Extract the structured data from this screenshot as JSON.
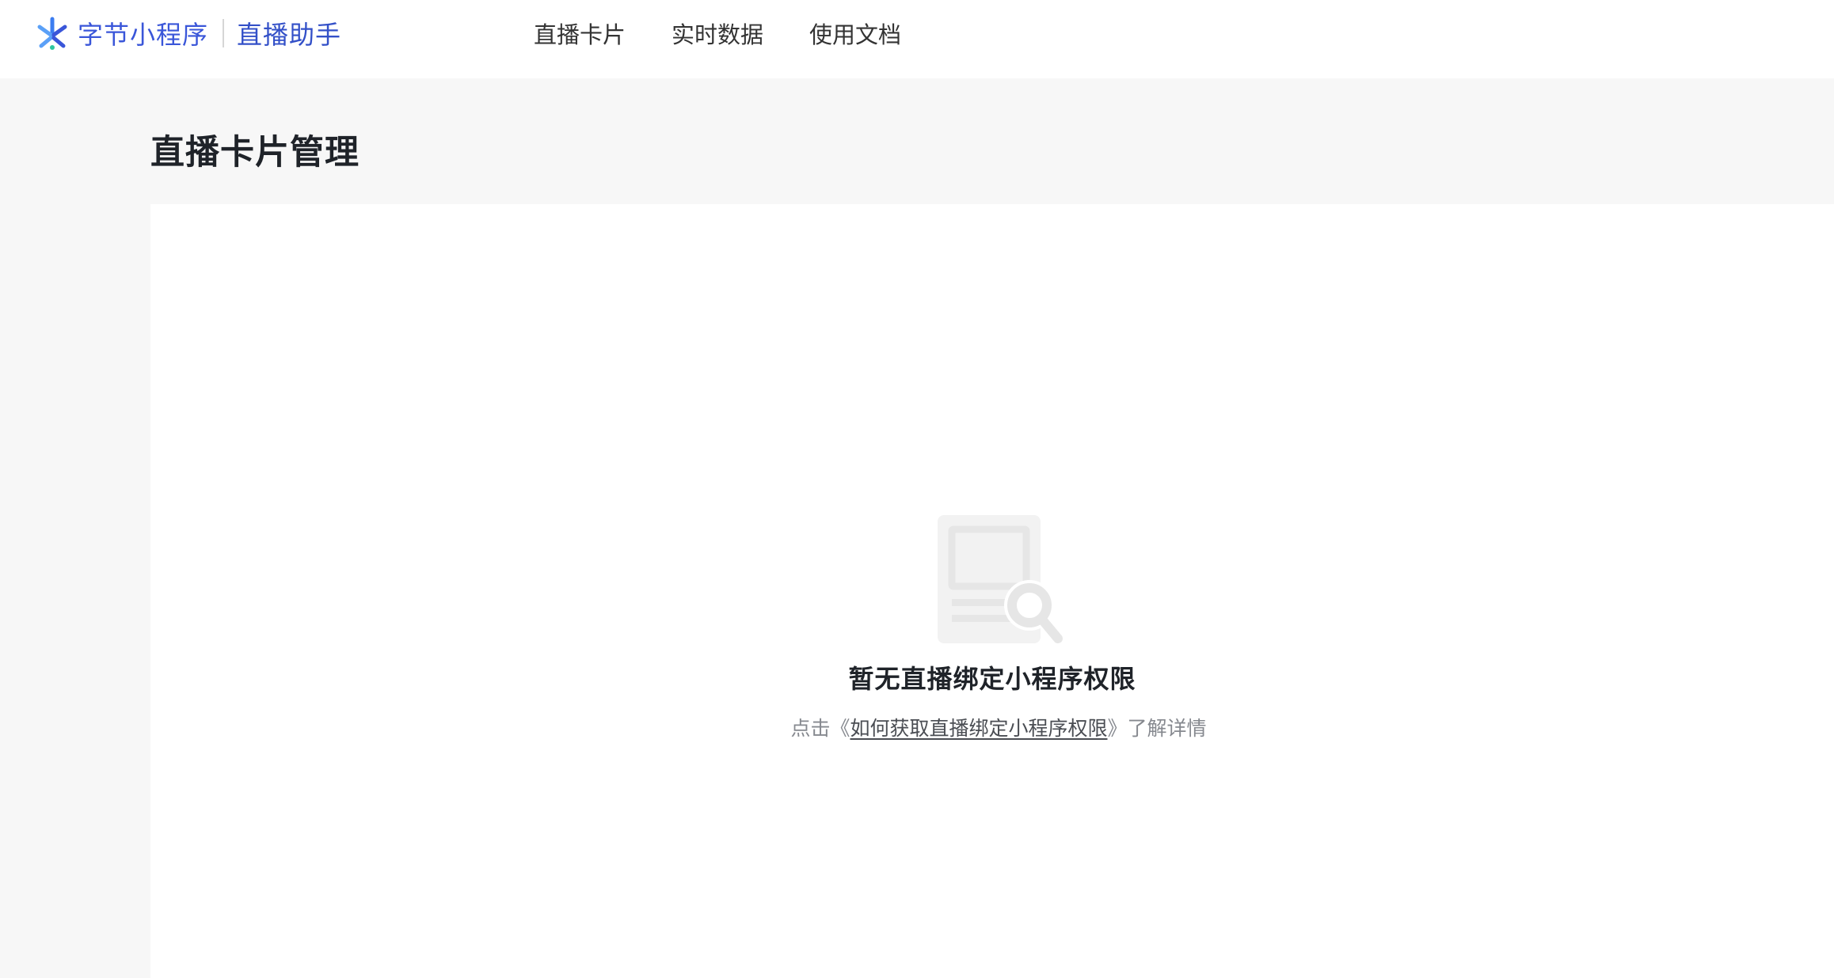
{
  "header": {
    "brand_name": "字节小程序",
    "product_name": "直播助手",
    "brand_logo_icon": "bytedance-miniapp-logo-icon",
    "brand_color": "#3a56d9",
    "nav": [
      {
        "label": "直播卡片"
      },
      {
        "label": "实时数据"
      },
      {
        "label": "使用文档"
      }
    ]
  },
  "main": {
    "page_title": "直播卡片管理",
    "empty_state": {
      "icon": "document-search-icon",
      "title": "暂无直播绑定小程序权限",
      "desc_prefix": "点击《",
      "desc_link": "如何获取直播绑定小程序权限",
      "desc_suffix": "》了解详情"
    }
  }
}
